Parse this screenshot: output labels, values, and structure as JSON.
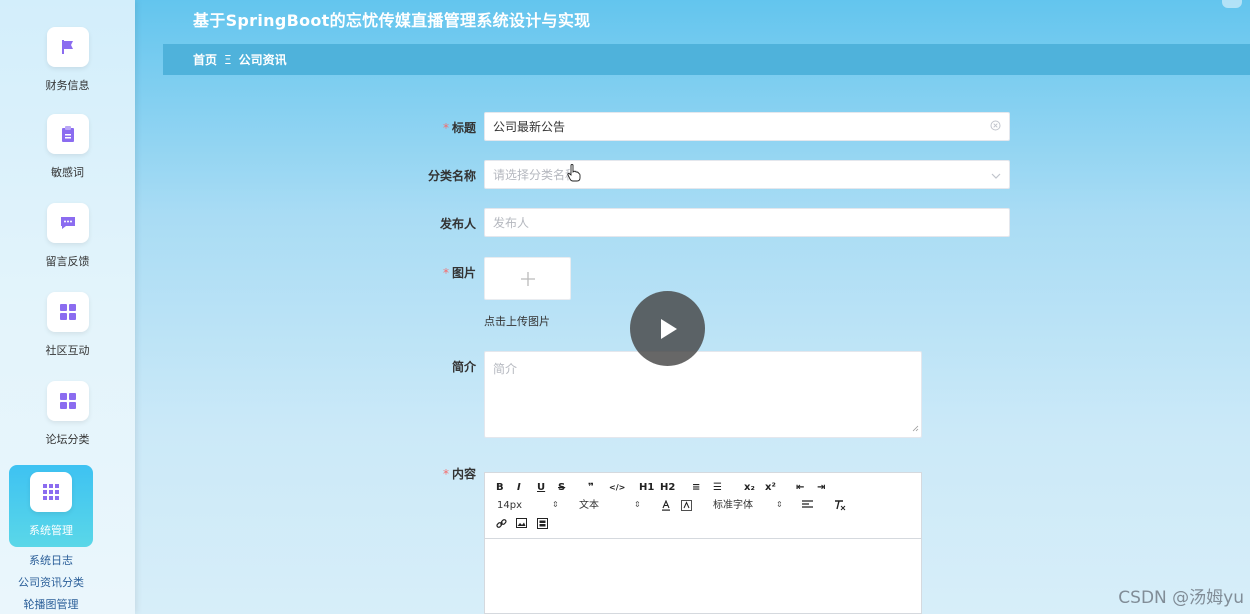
{
  "app": {
    "title": "基于SpringBoot的忘忧传媒直播管理系统设计与实现"
  },
  "breadcrumb": {
    "home": "首页",
    "separator": "Ξ",
    "current": "公司资讯"
  },
  "sidebar": {
    "items": [
      {
        "label": "财务信息",
        "icon": "flag-icon"
      },
      {
        "label": "敏感词",
        "icon": "clipboard-icon"
      },
      {
        "label": "留言反馈",
        "icon": "chat-bubble-icon"
      },
      {
        "label": "社区互动",
        "icon": "grid-icon"
      },
      {
        "label": "论坛分类",
        "icon": "grid-icon"
      },
      {
        "label": "系统管理",
        "icon": "grid-icon",
        "active": true
      }
    ],
    "subitems": [
      {
        "label": "系统日志"
      },
      {
        "label": "公司资讯分类"
      },
      {
        "label": "轮播图管理"
      }
    ]
  },
  "form": {
    "title": {
      "label": "标题",
      "required": true,
      "value": "公司最新公告"
    },
    "category": {
      "label": "分类名称",
      "required": false,
      "placeholder": "请选择分类名称"
    },
    "publisher": {
      "label": "发布人",
      "required": false,
      "placeholder": "发布人"
    },
    "image": {
      "label": "图片",
      "required": true,
      "hint": "点击上传图片"
    },
    "summary": {
      "label": "简介",
      "required": false,
      "placeholder": "简介"
    },
    "content": {
      "label": "内容",
      "required": true
    }
  },
  "editor": {
    "buttons": [
      "B",
      "I",
      "U",
      "S",
      "❞",
      "</>",
      "H1",
      "H2",
      "≡",
      "☰",
      "x₂",
      "x²",
      "⇤",
      "⇥"
    ],
    "font_size": "14px",
    "header_type": "文本",
    "font_family": "标准字体"
  },
  "watermark": "CSDN @汤姆yu",
  "colors": {
    "accent": "#4fb2db",
    "required": "#f56c6c",
    "active_nav": "#3ec2f2",
    "icon": "#8b6cf0"
  }
}
